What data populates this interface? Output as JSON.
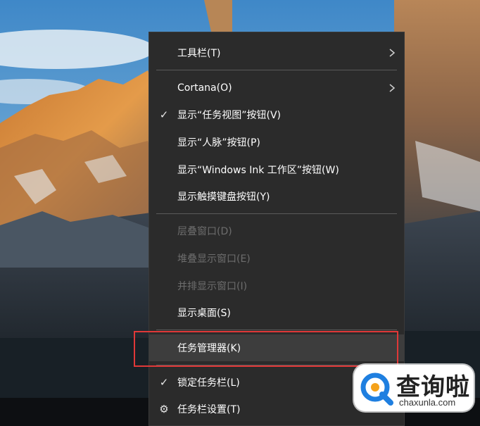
{
  "menu": {
    "items": [
      {
        "label": "工具栏(T)",
        "submenu": true,
        "disabled": false
      },
      {
        "label": "Cortana(O)",
        "submenu": true,
        "disabled": false
      },
      {
        "label": "显示“任务视图”按钮(V)",
        "checked": true,
        "disabled": false
      },
      {
        "label": "显示“人脉”按钮(P)",
        "disabled": false
      },
      {
        "label": "显示“Windows Ink 工作区”按钮(W)",
        "disabled": false
      },
      {
        "label": "显示触摸键盘按钮(Y)",
        "disabled": false
      },
      {
        "label": "层叠窗口(D)",
        "disabled": true
      },
      {
        "label": "堆叠显示窗口(E)",
        "disabled": true
      },
      {
        "label": "并排显示窗口(I)",
        "disabled": true
      },
      {
        "label": "显示桌面(S)",
        "disabled": false
      },
      {
        "label": "任务管理器(K)",
        "highlighted": true,
        "disabled": false
      },
      {
        "label": "锁定任务栏(L)",
        "checked": true,
        "disabled": false
      },
      {
        "label": "任务栏设置(T)",
        "icon": "gear-icon",
        "disabled": false
      }
    ]
  },
  "watermark": {
    "cn": "查询啦",
    "en": "chaxunla.com",
    "colors": {
      "blue": "#1f7fe0",
      "orange": "#f5a21a"
    }
  },
  "colors": {
    "menu_bg": "#2b2b2b",
    "highlight_bg": "#3d3d3d",
    "disabled_text": "#6d6d6d",
    "annotation_red": "#e03838"
  }
}
